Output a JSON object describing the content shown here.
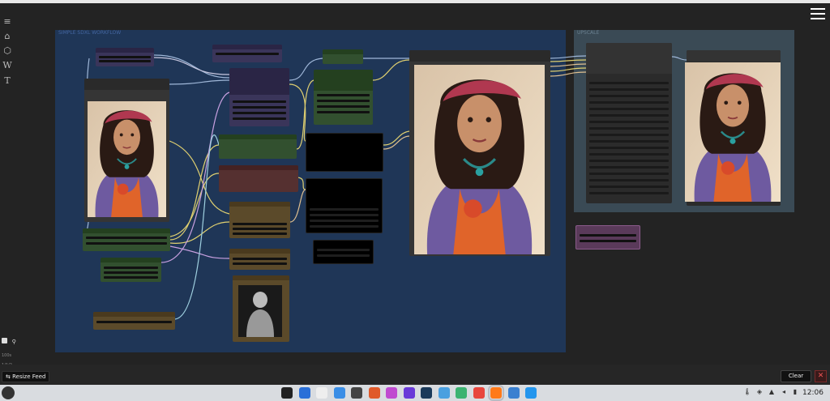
{
  "groups": {
    "main_title": "SIMPLE SDXL WORKFLOW",
    "upscale_title": "UPSCALE"
  },
  "feed": {
    "resize_label": "Resize Feed",
    "clear_label": "Clear",
    "close_symbol": "✕",
    "small_labels": [
      "100s",
      "1/1/2"
    ]
  },
  "taskbar": {
    "time": "12:06",
    "apps": [
      "terminal-icon",
      "browser-icon",
      "files-icon",
      "docs-icon",
      "settings-icon",
      "photos-icon",
      "media-icon",
      "vpn-icon",
      "store-icon",
      "vscode-icon",
      "play-icon",
      "chrome-icon",
      "firefox-icon",
      "window-icon",
      "docker-icon"
    ],
    "tray": [
      "thermometer-icon",
      "shield-icon",
      "network-icon",
      "volume-icon",
      "battery-icon"
    ]
  },
  "colors": {
    "group_blue": "#1f3657",
    "group_grey": "#3a4a55",
    "node_dark": "#353535",
    "node_green": "#32502f",
    "node_purple": "#3a355a",
    "node_red": "#553030",
    "node_brown": "#5b4a2a",
    "node_pink": "#5a3a5a"
  }
}
